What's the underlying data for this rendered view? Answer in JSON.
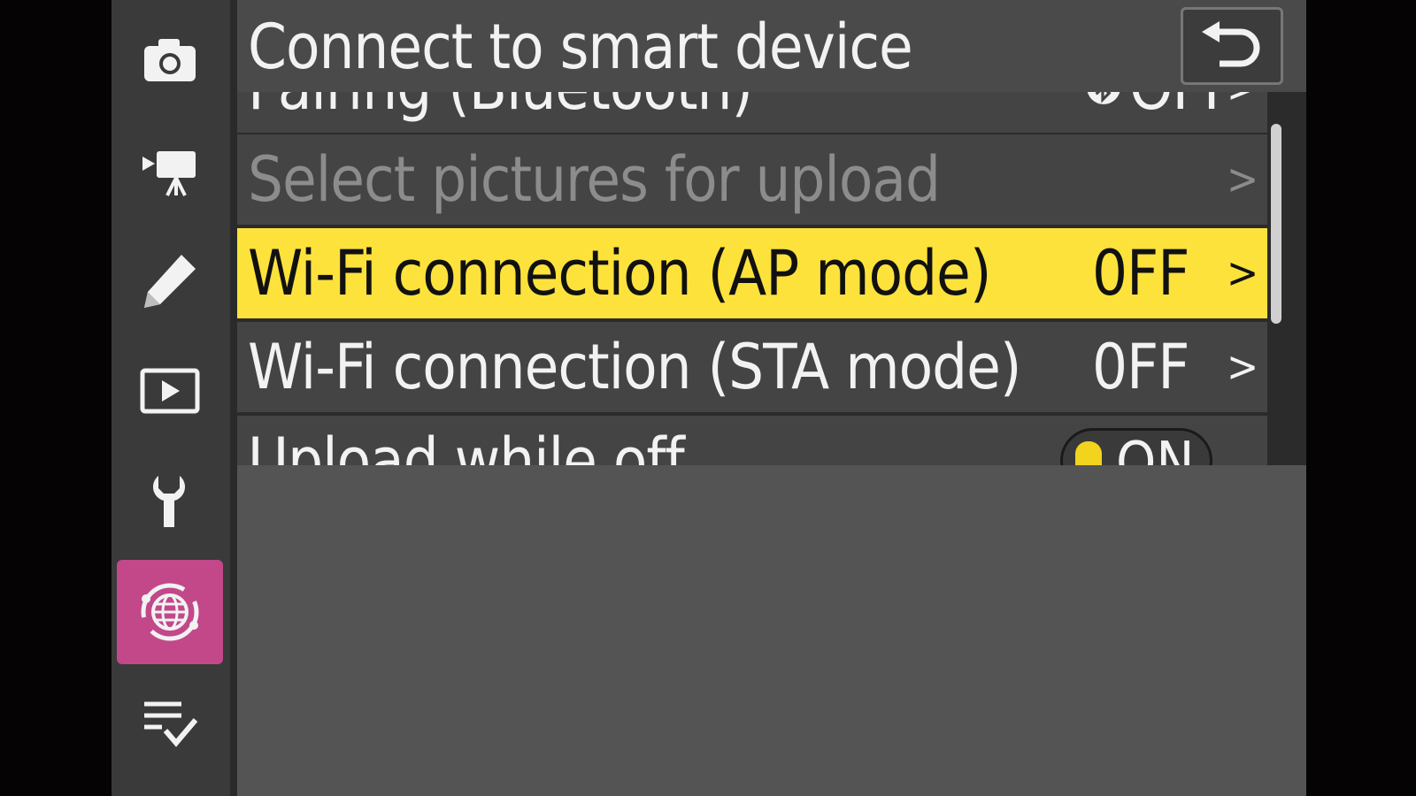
{
  "header": {
    "title": "Connect to smart device",
    "back_icon": "return-arrow-icon"
  },
  "sidebar": {
    "items": [
      {
        "id": "photo",
        "icon": "camera-icon",
        "active": false
      },
      {
        "id": "movie",
        "icon": "movie-camera-icon",
        "active": false
      },
      {
        "id": "custom",
        "icon": "pencil-icon",
        "active": false
      },
      {
        "id": "playback",
        "icon": "playback-icon",
        "active": false
      },
      {
        "id": "setup",
        "icon": "wrench-icon",
        "active": false
      },
      {
        "id": "network",
        "icon": "network-globe-icon",
        "active": true
      },
      {
        "id": "mymenu",
        "icon": "checklist-icon",
        "active": false
      }
    ],
    "active_color": "#c2488a"
  },
  "menu": {
    "items": [
      {
        "label": "Pairing (Bluetooth)",
        "value": "OFF",
        "state": "normal"
      },
      {
        "label": "Select pictures for upload",
        "value": "",
        "state": "disabled"
      },
      {
        "label": "Wi-Fi connection (AP mode)",
        "value": "0FF",
        "state": "selected"
      },
      {
        "label": "Wi-Fi connection (STA mode)",
        "value": "0FF",
        "state": "normal"
      },
      {
        "label": "Upload while off",
        "value": "ON",
        "state": "normal"
      }
    ],
    "chevron": ">",
    "highlight_color": "#fde23b"
  }
}
